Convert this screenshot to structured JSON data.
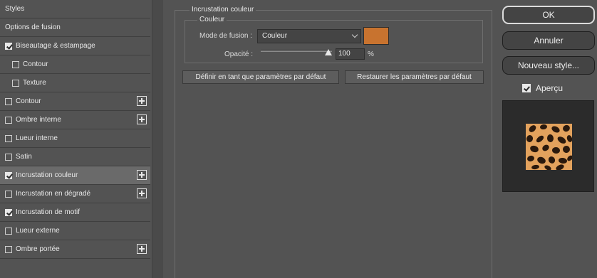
{
  "sidebar": {
    "items": [
      {
        "label": "Styles",
        "checkbox": false,
        "checked": false,
        "plus": false,
        "indent": false,
        "selected": false
      },
      {
        "label": "Options de fusion",
        "checkbox": false,
        "checked": false,
        "plus": false,
        "indent": false,
        "selected": false
      },
      {
        "label": "Biseautage & estampage",
        "checkbox": true,
        "checked": true,
        "plus": false,
        "indent": false,
        "selected": false
      },
      {
        "label": "Contour",
        "checkbox": true,
        "checked": false,
        "plus": false,
        "indent": true,
        "selected": false
      },
      {
        "label": "Texture",
        "checkbox": true,
        "checked": false,
        "plus": false,
        "indent": true,
        "selected": false
      },
      {
        "label": "Contour",
        "checkbox": true,
        "checked": false,
        "plus": true,
        "indent": false,
        "selected": false
      },
      {
        "label": "Ombre interne",
        "checkbox": true,
        "checked": false,
        "plus": true,
        "indent": false,
        "selected": false
      },
      {
        "label": "Lueur interne",
        "checkbox": true,
        "checked": false,
        "plus": false,
        "indent": false,
        "selected": false
      },
      {
        "label": "Satin",
        "checkbox": true,
        "checked": false,
        "plus": false,
        "indent": false,
        "selected": false
      },
      {
        "label": "Incrustation couleur",
        "checkbox": true,
        "checked": true,
        "plus": true,
        "indent": false,
        "selected": true
      },
      {
        "label": "Incrustation en dégradé",
        "checkbox": true,
        "checked": false,
        "plus": true,
        "indent": false,
        "selected": false
      },
      {
        "label": "Incrustation de motif",
        "checkbox": true,
        "checked": true,
        "plus": false,
        "indent": false,
        "selected": false
      },
      {
        "label": "Lueur externe",
        "checkbox": true,
        "checked": false,
        "plus": false,
        "indent": false,
        "selected": false
      },
      {
        "label": "Ombre portée",
        "checkbox": true,
        "checked": false,
        "plus": true,
        "indent": false,
        "selected": false
      }
    ]
  },
  "panel": {
    "title": "Incrustation couleur",
    "group_title": "Couleur",
    "blend_mode_label": "Mode de fusion :",
    "blend_mode_value": "Couleur",
    "color_hex": "#c8732f",
    "opacity_label": "Opacité :",
    "opacity_value": "100",
    "opacity_unit": "%",
    "opacity_level": 1.0,
    "set_default_label": "Définir en tant que paramètres par défaut",
    "reset_default_label": "Restaurer les paramètres par défaut"
  },
  "actions": {
    "ok_label": "OK",
    "cancel_label": "Annuler",
    "new_style_label": "Nouveau style...",
    "preview_label": "Aperçu",
    "preview_checked": true
  },
  "colors": {
    "background": "#535353",
    "selected_row": "#6a6a6a",
    "preview_fill": "#e3a25d",
    "preview_spots": "#2a190d"
  }
}
